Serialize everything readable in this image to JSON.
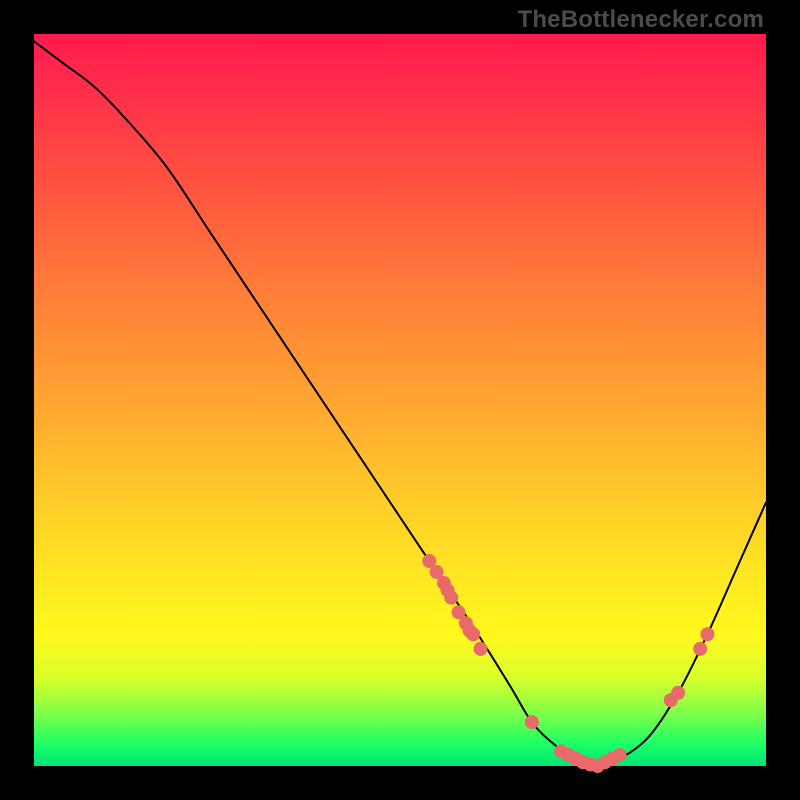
{
  "watermark": "TheBottlenecker.com",
  "colors": {
    "dot": "#e86a6a",
    "curve": "#000000",
    "background_top": "#ff1a4d",
    "background_bottom": "#00e676"
  },
  "chart_data": {
    "type": "line",
    "title": "",
    "xlabel": "",
    "ylabel": "",
    "xlim": [
      0,
      100
    ],
    "ylim": [
      0,
      100
    ],
    "series": [
      {
        "name": "bottleneck-curve",
        "x": [
          0,
          4,
          8,
          12,
          18,
          24,
          30,
          36,
          42,
          48,
          54,
          60,
          65,
          68,
          71,
          74,
          77,
          80,
          84,
          88,
          92,
          96,
          100
        ],
        "y": [
          99,
          96,
          93,
          89,
          82,
          73,
          64,
          55,
          46,
          37,
          28,
          19,
          11,
          6,
          3,
          1,
          0,
          1,
          4,
          10,
          18,
          27,
          36
        ]
      }
    ],
    "markers": {
      "name": "highlighted-points",
      "x": [
        54,
        55,
        56,
        56.5,
        57,
        58,
        59,
        59.5,
        60,
        61,
        68,
        72,
        73,
        74,
        75,
        76,
        77,
        78,
        79,
        80,
        87,
        88,
        91,
        92
      ],
      "y": [
        28,
        26.5,
        25,
        24,
        23,
        21,
        19.5,
        18.5,
        18,
        16,
        6,
        2,
        1.5,
        1,
        0.5,
        0.2,
        0,
        0.5,
        1,
        1.5,
        9,
        10,
        16,
        18
      ]
    }
  }
}
